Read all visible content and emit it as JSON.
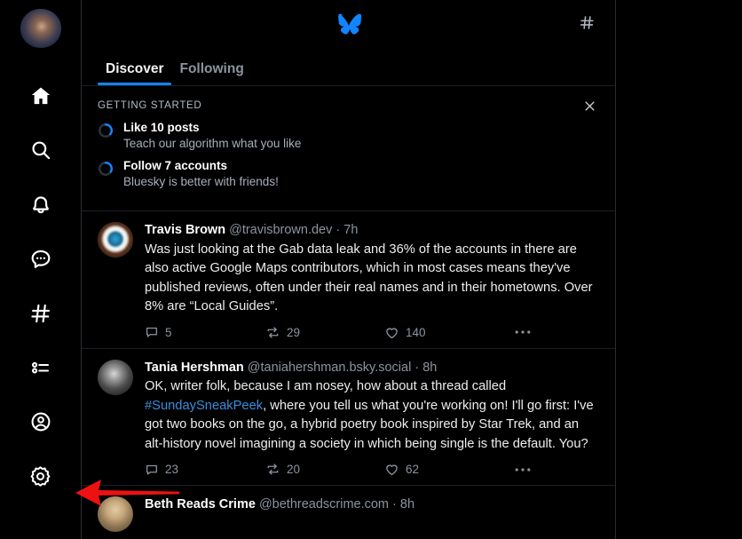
{
  "app": {
    "name": "Bluesky",
    "accent_color": "#1185fe",
    "background": "#000000"
  },
  "sidebar": {
    "avatar_name": "user-avatar",
    "items": [
      {
        "icon": "home-icon",
        "label": "Home"
      },
      {
        "icon": "search-icon",
        "label": "Search"
      },
      {
        "icon": "bell-icon",
        "label": "Notifications"
      },
      {
        "icon": "chat-icon",
        "label": "Chat"
      },
      {
        "icon": "hashtag-icon",
        "label": "Feeds"
      },
      {
        "icon": "lists-icon",
        "label": "Lists"
      },
      {
        "icon": "profile-icon",
        "label": "Profile"
      },
      {
        "icon": "settings-icon",
        "label": "Settings"
      }
    ]
  },
  "header": {
    "logo_icon": "bluesky-butterfly-logo",
    "action_icon": "hashtag-icon",
    "tabs": [
      {
        "label": "Discover",
        "active": true
      },
      {
        "label": "Following",
        "active": false
      }
    ]
  },
  "getting_started": {
    "title": "GETTING STARTED",
    "close_icon": "close-icon",
    "items": [
      {
        "title": "Like 10 posts",
        "subtitle": "Teach our algorithm what you like",
        "progress_icon": "progress-ring-icon"
      },
      {
        "title": "Follow 7 accounts",
        "subtitle": "Bluesky is better with friends!",
        "progress_icon": "progress-ring-icon"
      }
    ]
  },
  "feed": {
    "posts": [
      {
        "avatar": "eye-avatar",
        "name": "Travis Brown",
        "handle": "@travisbrown.dev",
        "separator": "·",
        "time": "7h",
        "text": "Was just looking at the Gab data leak and 36% of the accounts in there are also active Google Maps contributors, which in most cases means they've published reviews, often under their real names and in their hometowns. Over 8% are “Local Guides”.",
        "reply_count": "5",
        "repost_count": "29",
        "like_count": "140",
        "more_icon": "ellipsis-icon"
      },
      {
        "avatar": "bw-portrait-avatar",
        "name": "Tania Hershman",
        "handle": "@taniahershman.bsky.social",
        "separator": "·",
        "time": "8h",
        "text_before": "OK, writer folk, because I am nosey, how about a thread called ",
        "hashtag": "#SundaySneakPeek",
        "text_after": ", where you tell us what you're working on! I'll go first: I've got two books on the go, a hybrid poetry book inspired by Star Trek, and an alt-history novel imagining a society in which being single is the default. You?",
        "reply_count": "23",
        "repost_count": "20",
        "like_count": "62",
        "more_icon": "ellipsis-icon"
      },
      {
        "avatar": "blonde-avatar",
        "name": "Beth Reads Crime",
        "handle": "@bethreadscrime.com",
        "separator": "·",
        "time": "8h"
      }
    ]
  },
  "annotation": {
    "arrow_icon": "red-arrow-left",
    "color": "#ee1111"
  }
}
